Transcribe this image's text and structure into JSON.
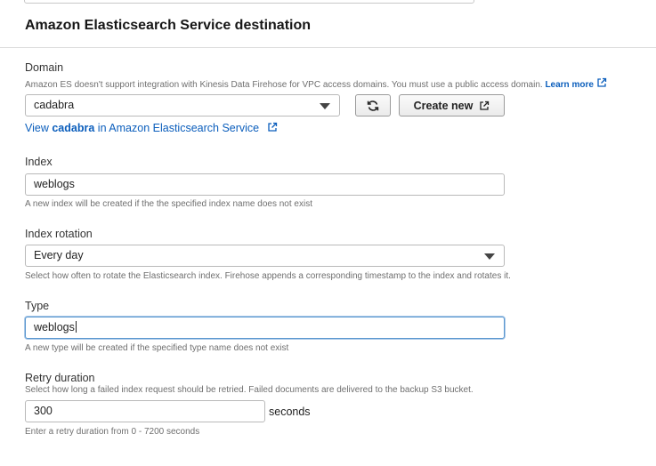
{
  "section": {
    "title": "Amazon Elasticsearch Service destination"
  },
  "domain": {
    "label": "Domain",
    "help": "Amazon ES doesn't support integration with Kinesis Data Firehose for VPC access domains. You must use a public access domain.",
    "learn_more": "Learn more",
    "selected": "cadabra",
    "create_new_label": "Create new",
    "view_prefix": "View",
    "view_domain": "cadabra",
    "view_suffix": "in Amazon Elasticsearch Service"
  },
  "index": {
    "label": "Index",
    "value": "weblogs",
    "help": "A new index will be created if the the specified index name does not exist"
  },
  "index_rotation": {
    "label": "Index rotation",
    "selected": "Every day",
    "help": "Select how often to rotate the Elasticsearch index. Firehose appends a corresponding timestamp to the index and rotates it."
  },
  "type": {
    "label": "Type",
    "value": "weblogs",
    "help": "A new type will be created if the specified type name does not exist"
  },
  "retry": {
    "label": "Retry duration",
    "help": "Select how long a failed index request should be retried. Failed documents are delivered to the backup S3 bucket.",
    "value": "300",
    "unit": "seconds",
    "hint": "Enter a retry duration from 0 - 7200 seconds"
  },
  "icons": {
    "refresh": "refresh-icon",
    "external_link": "external-link-icon",
    "dropdown": "chevron-down-icon"
  },
  "colors": {
    "link": "#0b5ebc",
    "focus_border": "#5a97cf",
    "help_text": "#6f6f6f"
  }
}
